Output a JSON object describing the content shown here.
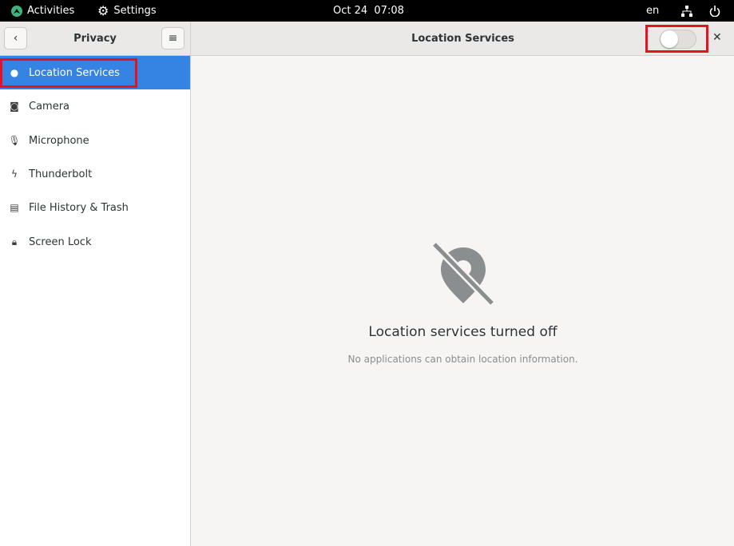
{
  "topbar": {
    "activities": "Activities",
    "app": "Settings",
    "clock": "Oct 24  07:08",
    "lang": "en"
  },
  "sidebar": {
    "title": "Privacy",
    "items": [
      {
        "label": "Location Services",
        "icon": "map-pin-icon",
        "selected": true
      },
      {
        "label": "Camera",
        "icon": "camera-icon"
      },
      {
        "label": "Microphone",
        "icon": "microphone-icon"
      },
      {
        "label": "Thunderbolt",
        "icon": "thunderbolt-icon"
      },
      {
        "label": "File History & Trash",
        "icon": "file-history-icon"
      },
      {
        "label": "Screen Lock",
        "icon": "lock-icon"
      }
    ]
  },
  "header": {
    "title": "Location Services",
    "switch_on": false
  },
  "main": {
    "title": "Location services turned off",
    "subtitle": "No applications can obtain location information."
  }
}
